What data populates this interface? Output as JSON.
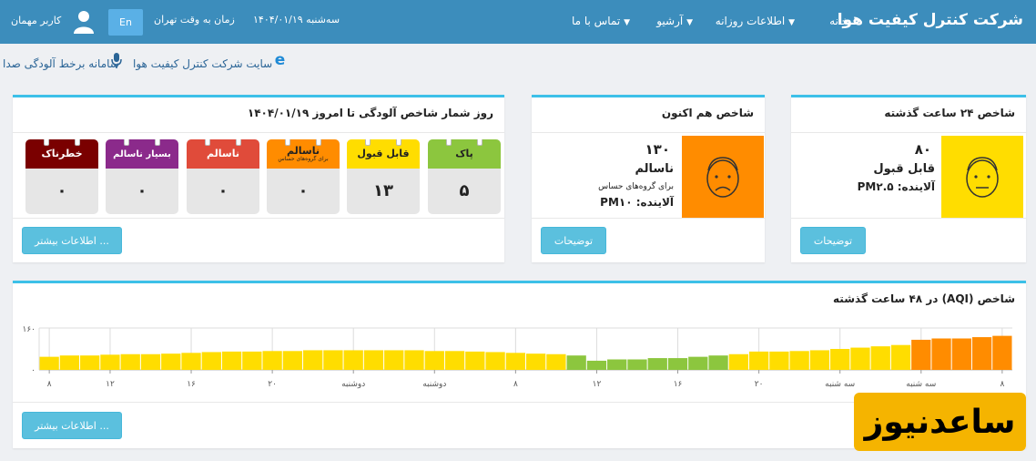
{
  "navbar": {
    "brand": "شرکت کنترل کیفیت هوا",
    "links": [
      {
        "label": "خانه",
        "caret": false
      },
      {
        "label": "اطلاعات روزانه",
        "caret": true
      },
      {
        "label": "آرشیو",
        "caret": true
      },
      {
        "label": "تماس با ما",
        "caret": true
      }
    ],
    "datetime": "سه‌شنبه ۱۴۰۴/۰۱/۱۹",
    "timezone": "زمان به وقت تهران",
    "lang_button": "En",
    "guest": "کاربر مهمان"
  },
  "sublinks": {
    "site": "سایت شرکت کنترل کیفیت هوا",
    "noise": "سامانه برخط آلودگی صدا"
  },
  "panel_24h": {
    "title": "شاخص ۲۴ ساعت گذشته",
    "value": "۸۰",
    "status": "قابل قبول",
    "pollutant": "آلاینده: PM۲.۵",
    "button": "توضیحات",
    "color": "#ffdd00"
  },
  "panel_now": {
    "title": "شاخص هم اکنون",
    "value": "۱۳۰",
    "status": "ناسالم",
    "note": "برای گروه‌های حساس",
    "pollutant": "آلاینده: PM۱۰",
    "button": "توضیحات",
    "color": "#ff8c00"
  },
  "panel_counter": {
    "title": "روز شمار شاخص آلودگی تا امروز ۱۴۰۴/۰۱/۱۹",
    "button": "اطلاعات بیشتر ...",
    "cards": [
      {
        "label": "پاک",
        "sub": "",
        "count": "۵",
        "color": "#8cc63e"
      },
      {
        "label": "قابل قبول",
        "sub": "",
        "count": "۱۳",
        "color": "#ffdd00"
      },
      {
        "label": "ناسالم",
        "sub": "برای گروه‌های حساس",
        "count": "۰",
        "color": "#ff8c00"
      },
      {
        "label": "ناسالم",
        "sub": "",
        "count": "۰",
        "color": "#e04b3a"
      },
      {
        "label": "بسیار ناسالم",
        "sub": "",
        "count": "۰",
        "color": "#8b2a8b"
      },
      {
        "label": "خطرناک",
        "sub": "",
        "count": "۰",
        "color": "#7a0000"
      }
    ]
  },
  "panel_chart": {
    "title": "شاخص (AQI) در ۴۸ ساعت گذشته",
    "button": "اطلاعات بیشتر ..."
  },
  "chart_data": {
    "type": "bar",
    "title": "شاخص (AQI) در ۴۸ ساعت گذشته",
    "ylim": [
      0,
      160
    ],
    "yticks": [
      "۱۶۰",
      "۰"
    ],
    "grid": true,
    "values": [
      130,
      125,
      120,
      120,
      115,
      95,
      90,
      85,
      80,
      75,
      72,
      70,
      70,
      60,
      55,
      50,
      45,
      45,
      40,
      40,
      35,
      55,
      60,
      62,
      65,
      68,
      70,
      72,
      72,
      75,
      75,
      75,
      75,
      75,
      75,
      72,
      72,
      70,
      70,
      68,
      65,
      62,
      60,
      60,
      58,
      55,
      55,
      50
    ],
    "colors": [
      "#ff8c00",
      "#ff8c00",
      "#ff8c00",
      "#ff8c00",
      "#ff8c00",
      "#ffdd00",
      "#ffdd00",
      "#ffdd00",
      "#ffdd00",
      "#ffdd00",
      "#ffdd00",
      "#ffdd00",
      "#ffdd00",
      "#ffdd00",
      "#8cc63e",
      "#8cc63e",
      "#8cc63e",
      "#8cc63e",
      "#8cc63e",
      "#8cc63e",
      "#8cc63e",
      "#8cc63e",
      "#ffdd00",
      "#ffdd00",
      "#ffdd00",
      "#ffdd00",
      "#ffdd00",
      "#ffdd00",
      "#ffdd00",
      "#ffdd00",
      "#ffdd00",
      "#ffdd00",
      "#ffdd00",
      "#ffdd00",
      "#ffdd00",
      "#ffdd00",
      "#ffdd00",
      "#ffdd00",
      "#ffdd00",
      "#ffdd00",
      "#ffdd00",
      "#ffdd00",
      "#ffdd00",
      "#ffdd00",
      "#ffdd00",
      "#ffdd00",
      "#ffdd00",
      "#ffdd00"
    ],
    "xticks": [
      {
        "index": 0,
        "label": "۸"
      },
      {
        "index": 4,
        "label": "سه شنبه"
      },
      {
        "index": 8,
        "label": "سه شنبه"
      },
      {
        "index": 12,
        "label": "۲۰"
      },
      {
        "index": 16,
        "label": "۱۶"
      },
      {
        "index": 20,
        "label": "۱۲"
      },
      {
        "index": 24,
        "label": "۸"
      },
      {
        "index": 28,
        "label": "دوشنبه"
      },
      {
        "index": 32,
        "label": "دوشنبه"
      },
      {
        "index": 36,
        "label": "۲۰"
      },
      {
        "index": 40,
        "label": "۱۶"
      },
      {
        "index": 44,
        "label": "۱۲"
      },
      {
        "index": 47,
        "label": "۸"
      }
    ]
  },
  "watermark": "ساعدنیوز"
}
